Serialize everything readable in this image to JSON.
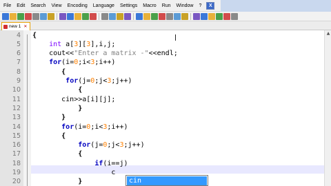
{
  "menu": {
    "items": [
      "File",
      "Edit",
      "Search",
      "View",
      "Encoding",
      "Language",
      "Settings",
      "Macro",
      "Run",
      "Window",
      "?"
    ],
    "close_label": "X"
  },
  "tab": {
    "label": "new 1"
  },
  "editor": {
    "lines": [
      {
        "no": "4",
        "html_parts": [
          {
            "t": "{",
            "c": "brace"
          }
        ]
      },
      {
        "no": "5",
        "html_parts": [
          {
            "t": "    "
          },
          {
            "t": "int",
            "c": "kwt"
          },
          {
            "t": " a["
          },
          {
            "t": "3",
            "c": "num"
          },
          {
            "t": "]["
          },
          {
            "t": "3",
            "c": "num"
          },
          {
            "t": "],i,j;"
          }
        ]
      },
      {
        "no": "6",
        "html_parts": [
          {
            "t": "    cout<<"
          },
          {
            "t": "\"Enter a matrix -\"",
            "c": "str"
          },
          {
            "t": "<<endl;"
          }
        ]
      },
      {
        "no": "7",
        "html_parts": [
          {
            "t": "    "
          },
          {
            "t": "for",
            "c": "kw"
          },
          {
            "t": "(i="
          },
          {
            "t": "0",
            "c": "num"
          },
          {
            "t": ";i<"
          },
          {
            "t": "3",
            "c": "num"
          },
          {
            "t": ";i++)"
          }
        ]
      },
      {
        "no": "8",
        "html_parts": [
          {
            "t": "       {",
            "c": "brace"
          }
        ]
      },
      {
        "no": "9",
        "html_parts": [
          {
            "t": "        "
          },
          {
            "t": "for",
            "c": "kw"
          },
          {
            "t": "(j="
          },
          {
            "t": "0",
            "c": "num"
          },
          {
            "t": ";j<"
          },
          {
            "t": "3",
            "c": "num"
          },
          {
            "t": ";j++)"
          }
        ]
      },
      {
        "no": "10",
        "html_parts": [
          {
            "t": "           {",
            "c": "brace"
          }
        ]
      },
      {
        "no": "11",
        "html_parts": [
          {
            "t": "       cin>>a[i][j];"
          }
        ]
      },
      {
        "no": "12",
        "html_parts": [
          {
            "t": "           }",
            "c": "brace"
          }
        ]
      },
      {
        "no": "13",
        "html_parts": [
          {
            "t": "       }",
            "c": "brace"
          }
        ]
      },
      {
        "no": "14",
        "html_parts": [
          {
            "t": "       "
          },
          {
            "t": "for",
            "c": "kw"
          },
          {
            "t": "(i="
          },
          {
            "t": "0",
            "c": "num"
          },
          {
            "t": ";i<"
          },
          {
            "t": "3",
            "c": "num"
          },
          {
            "t": ";i++)"
          }
        ]
      },
      {
        "no": "15",
        "html_parts": [
          {
            "t": "       {",
            "c": "brace"
          }
        ]
      },
      {
        "no": "16",
        "html_parts": [
          {
            "t": "           "
          },
          {
            "t": "for",
            "c": "kw"
          },
          {
            "t": "(j="
          },
          {
            "t": "0",
            "c": "num"
          },
          {
            "t": ";j<"
          },
          {
            "t": "3",
            "c": "num"
          },
          {
            "t": ";j++)"
          }
        ]
      },
      {
        "no": "17",
        "html_parts": [
          {
            "t": "           {",
            "c": "brace"
          }
        ]
      },
      {
        "no": "18",
        "html_parts": [
          {
            "t": "               "
          },
          {
            "t": "if",
            "c": "kw"
          },
          {
            "t": "(i==j)"
          }
        ]
      },
      {
        "no": "19",
        "html_parts": [
          {
            "t": "                   c"
          }
        ]
      },
      {
        "no": "20",
        "html_parts": [
          {
            "t": "           }",
            "c": "brace"
          }
        ]
      }
    ]
  },
  "autocomplete": {
    "selected": "cin"
  },
  "icons": {
    "toolbar": [
      "new-icon",
      "open-icon",
      "save-icon",
      "save-all-icon",
      "close-icon",
      "close-all-icon",
      "print-icon",
      "cut-icon",
      "copy-icon",
      "paste-icon",
      "undo-icon",
      "redo-icon",
      "find-icon",
      "replace-icon",
      "zoom-in-icon",
      "zoom-out-icon",
      "sync-v-icon",
      "sync-h-icon",
      "wrap-icon",
      "show-all-icon",
      "indent-guide-icon",
      "lang-icon",
      "bookmark-icon",
      "folder-icon",
      "record-icon",
      "stop-icon",
      "play-icon",
      "play-multi-icon",
      "save-macro-icon"
    ]
  },
  "colors": {
    "keyword": "#0000c0",
    "type": "#7a00ff",
    "string": "#808080",
    "number": "#ff8000",
    "autocomplete_selected": "#3399ff",
    "tab_border": "#e8a000"
  }
}
